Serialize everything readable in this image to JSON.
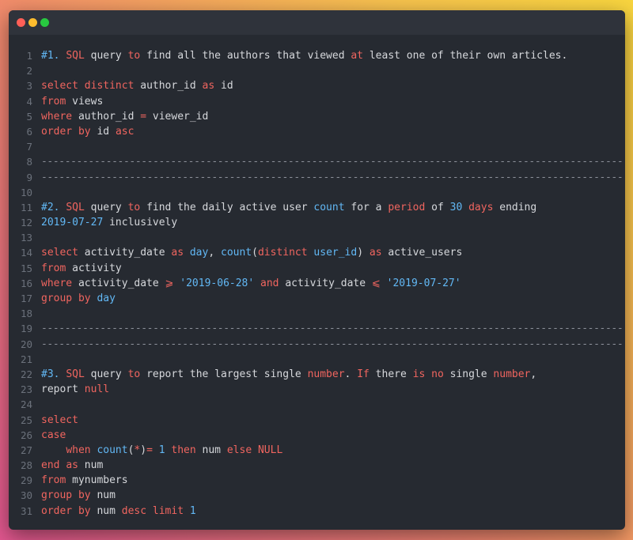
{
  "window": {
    "controls": [
      "close",
      "minimize",
      "maximize"
    ],
    "colors": {
      "close": "#fe5f57",
      "minimize": "#febc2e",
      "maximize": "#28c840",
      "background": "#262a31",
      "keyword": "#f0655f",
      "highlight": "#62b8f5"
    }
  },
  "code": {
    "line_numbers": [
      "1",
      "2",
      "3",
      "4",
      "5",
      "6",
      "7",
      "8",
      "9",
      "10",
      "11",
      "12",
      "13",
      "14",
      "15",
      "16",
      "17",
      "18",
      "19",
      "20",
      "21",
      "22",
      "23",
      "24",
      "25",
      "26",
      "27",
      "28",
      "29",
      "30",
      "31"
    ],
    "lines": [
      [
        [
          "#1. ",
          "cm"
        ],
        [
          "SQL",
          "kw"
        ],
        [
          " query ",
          ""
        ],
        [
          "to",
          "kw"
        ],
        [
          " find all the authors that viewed ",
          ""
        ],
        [
          "at",
          "kw"
        ],
        [
          " least one of their own articles.",
          ""
        ]
      ],
      [],
      [
        [
          "select",
          "kw"
        ],
        [
          " ",
          ""
        ],
        [
          "distinct",
          "kw"
        ],
        [
          " author_id ",
          ""
        ],
        [
          "as",
          "kw"
        ],
        [
          " id",
          ""
        ]
      ],
      [
        [
          "from",
          "kw"
        ],
        [
          " views",
          ""
        ]
      ],
      [
        [
          "where",
          "kw"
        ],
        [
          " author_id ",
          ""
        ],
        [
          "=",
          "kw"
        ],
        [
          " viewer_id",
          ""
        ]
      ],
      [
        [
          "order by",
          "kw"
        ],
        [
          " id ",
          ""
        ],
        [
          "asc",
          "kw"
        ]
      ],
      [],
      [
        [
          "-----------------------------------------------------------------------------------------------------------------",
          "dash"
        ]
      ],
      [
        [
          "-----------------------------------------------------------------------------------------------------------------",
          "dash"
        ]
      ],
      [],
      [
        [
          "#2. ",
          "cm"
        ],
        [
          "SQL",
          "kw"
        ],
        [
          " query ",
          ""
        ],
        [
          "to",
          "kw"
        ],
        [
          " find the daily active user ",
          ""
        ],
        [
          "count",
          "blue"
        ],
        [
          " for a ",
          ""
        ],
        [
          "period",
          "kw"
        ],
        [
          " of ",
          ""
        ],
        [
          "30",
          "num"
        ],
        [
          " ",
          ""
        ],
        [
          "days",
          "kw"
        ],
        [
          " ending",
          ""
        ]
      ],
      [
        [
          "2019-07-27",
          "cm"
        ],
        [
          " inclusively",
          ""
        ]
      ],
      [],
      [
        [
          "select",
          "kw"
        ],
        [
          " activity_date ",
          ""
        ],
        [
          "as",
          "kw"
        ],
        [
          " ",
          ""
        ],
        [
          "day",
          "blue"
        ],
        [
          ", ",
          ""
        ],
        [
          "count",
          "blue"
        ],
        [
          "(",
          ""
        ],
        [
          "distinct",
          "kw"
        ],
        [
          " ",
          ""
        ],
        [
          "user_id",
          "blue"
        ],
        [
          ") ",
          ""
        ],
        [
          "as",
          "kw"
        ],
        [
          " active_users",
          ""
        ]
      ],
      [
        [
          "from",
          "kw"
        ],
        [
          " activity",
          ""
        ]
      ],
      [
        [
          "where",
          "kw"
        ],
        [
          " activity_date ",
          ""
        ],
        [
          "⩾",
          "kw"
        ],
        [
          " ",
          ""
        ],
        [
          "'2019-06-28'",
          "str"
        ],
        [
          " ",
          ""
        ],
        [
          "and",
          "kw"
        ],
        [
          " activity_date ",
          ""
        ],
        [
          "⩽",
          "kw"
        ],
        [
          " ",
          ""
        ],
        [
          "'2019-07-27'",
          "str"
        ]
      ],
      [
        [
          "group by",
          "kw"
        ],
        [
          " ",
          ""
        ],
        [
          "day",
          "blue"
        ]
      ],
      [],
      [
        [
          "-----------------------------------------------------------------------------------------------------------------",
          "dash"
        ]
      ],
      [
        [
          "-----------------------------------------------------------------------------------------------------------------",
          "dash"
        ]
      ],
      [],
      [
        [
          "#3. ",
          "cm"
        ],
        [
          "SQL",
          "kw"
        ],
        [
          " query ",
          ""
        ],
        [
          "to",
          "kw"
        ],
        [
          " report the largest single ",
          ""
        ],
        [
          "number",
          "kw"
        ],
        [
          ". ",
          ""
        ],
        [
          "If",
          "kw"
        ],
        [
          " there ",
          ""
        ],
        [
          "is",
          "kw"
        ],
        [
          " ",
          ""
        ],
        [
          "no",
          "kw"
        ],
        [
          " single ",
          ""
        ],
        [
          "number",
          "kw"
        ],
        [
          ",",
          ""
        ]
      ],
      [
        [
          "report ",
          ""
        ],
        [
          "null",
          "kw"
        ]
      ],
      [],
      [
        [
          "select",
          "kw"
        ]
      ],
      [
        [
          "case",
          "kw"
        ]
      ],
      [
        [
          "    ",
          ""
        ],
        [
          "when",
          "kw"
        ],
        [
          " ",
          ""
        ],
        [
          "count",
          "blue"
        ],
        [
          "(",
          ""
        ],
        [
          "*",
          "kw"
        ],
        [
          ")",
          ""
        ],
        [
          "=",
          "kw"
        ],
        [
          " ",
          ""
        ],
        [
          "1",
          "num"
        ],
        [
          " ",
          ""
        ],
        [
          "then",
          "kw"
        ],
        [
          " num ",
          ""
        ],
        [
          "else",
          "kw"
        ],
        [
          " ",
          ""
        ],
        [
          "NULL",
          "kw"
        ]
      ],
      [
        [
          "end",
          "kw"
        ],
        [
          " ",
          ""
        ],
        [
          "as",
          "kw"
        ],
        [
          " num",
          ""
        ]
      ],
      [
        [
          "from",
          "kw"
        ],
        [
          " mynumbers",
          ""
        ]
      ],
      [
        [
          "group by",
          "kw"
        ],
        [
          " num",
          ""
        ]
      ],
      [
        [
          "order by",
          "kw"
        ],
        [
          " num ",
          ""
        ],
        [
          "desc",
          "kw"
        ],
        [
          " ",
          ""
        ],
        [
          "limit",
          "kw"
        ],
        [
          " ",
          ""
        ],
        [
          "1",
          "num"
        ]
      ]
    ]
  }
}
